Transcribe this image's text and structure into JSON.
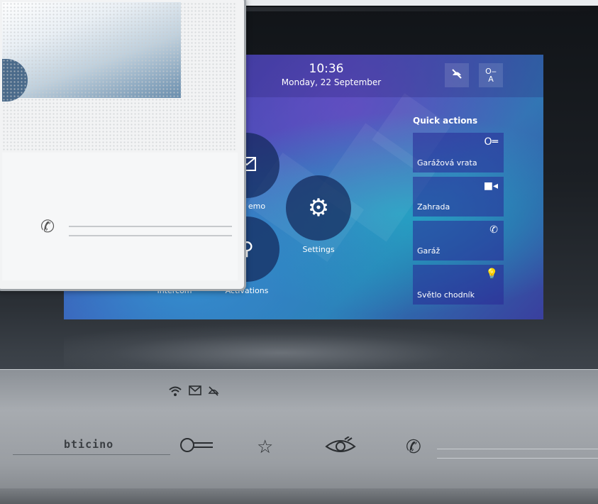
{
  "status_bar": {
    "time": "10:36",
    "date": "Monday, 22 September"
  },
  "top_buttons": [
    "do-not-disturb-icon",
    "key-a-icon"
  ],
  "menu": {
    "items": [
      {
        "label": "Intercom",
        "icon": "intercom-icon"
      },
      {
        "label": "Activations",
        "icon": "activations-icon"
      },
      {
        "label": "Settings",
        "icon": "gear-icon"
      },
      {
        "label": "emo",
        "icon": "envelope-icon"
      }
    ]
  },
  "quick_actions": {
    "title": "Quick actions",
    "items": [
      {
        "label": "Garážová vrata",
        "icon": "key-icon"
      },
      {
        "label": "Zahrada",
        "icon": "camera-icon"
      },
      {
        "label": "Garáž",
        "icon": "phone-icon"
      },
      {
        "label": "Světlo chodník",
        "icon": "lightbulb-icon"
      }
    ]
  },
  "bottom_panel": {
    "brand": "bticino",
    "indicators": [
      "wifi-icon",
      "mail-icon",
      "mute-icon"
    ],
    "controls": [
      "key-icon",
      "star-icon",
      "eye-icon",
      "phone-icon"
    ]
  },
  "colors": {
    "screen_primary": "#3f55b6",
    "screen_accent": "#2a7bb2",
    "tile_bg": "#2a2a96",
    "panel_silver": "#a7abb0"
  }
}
